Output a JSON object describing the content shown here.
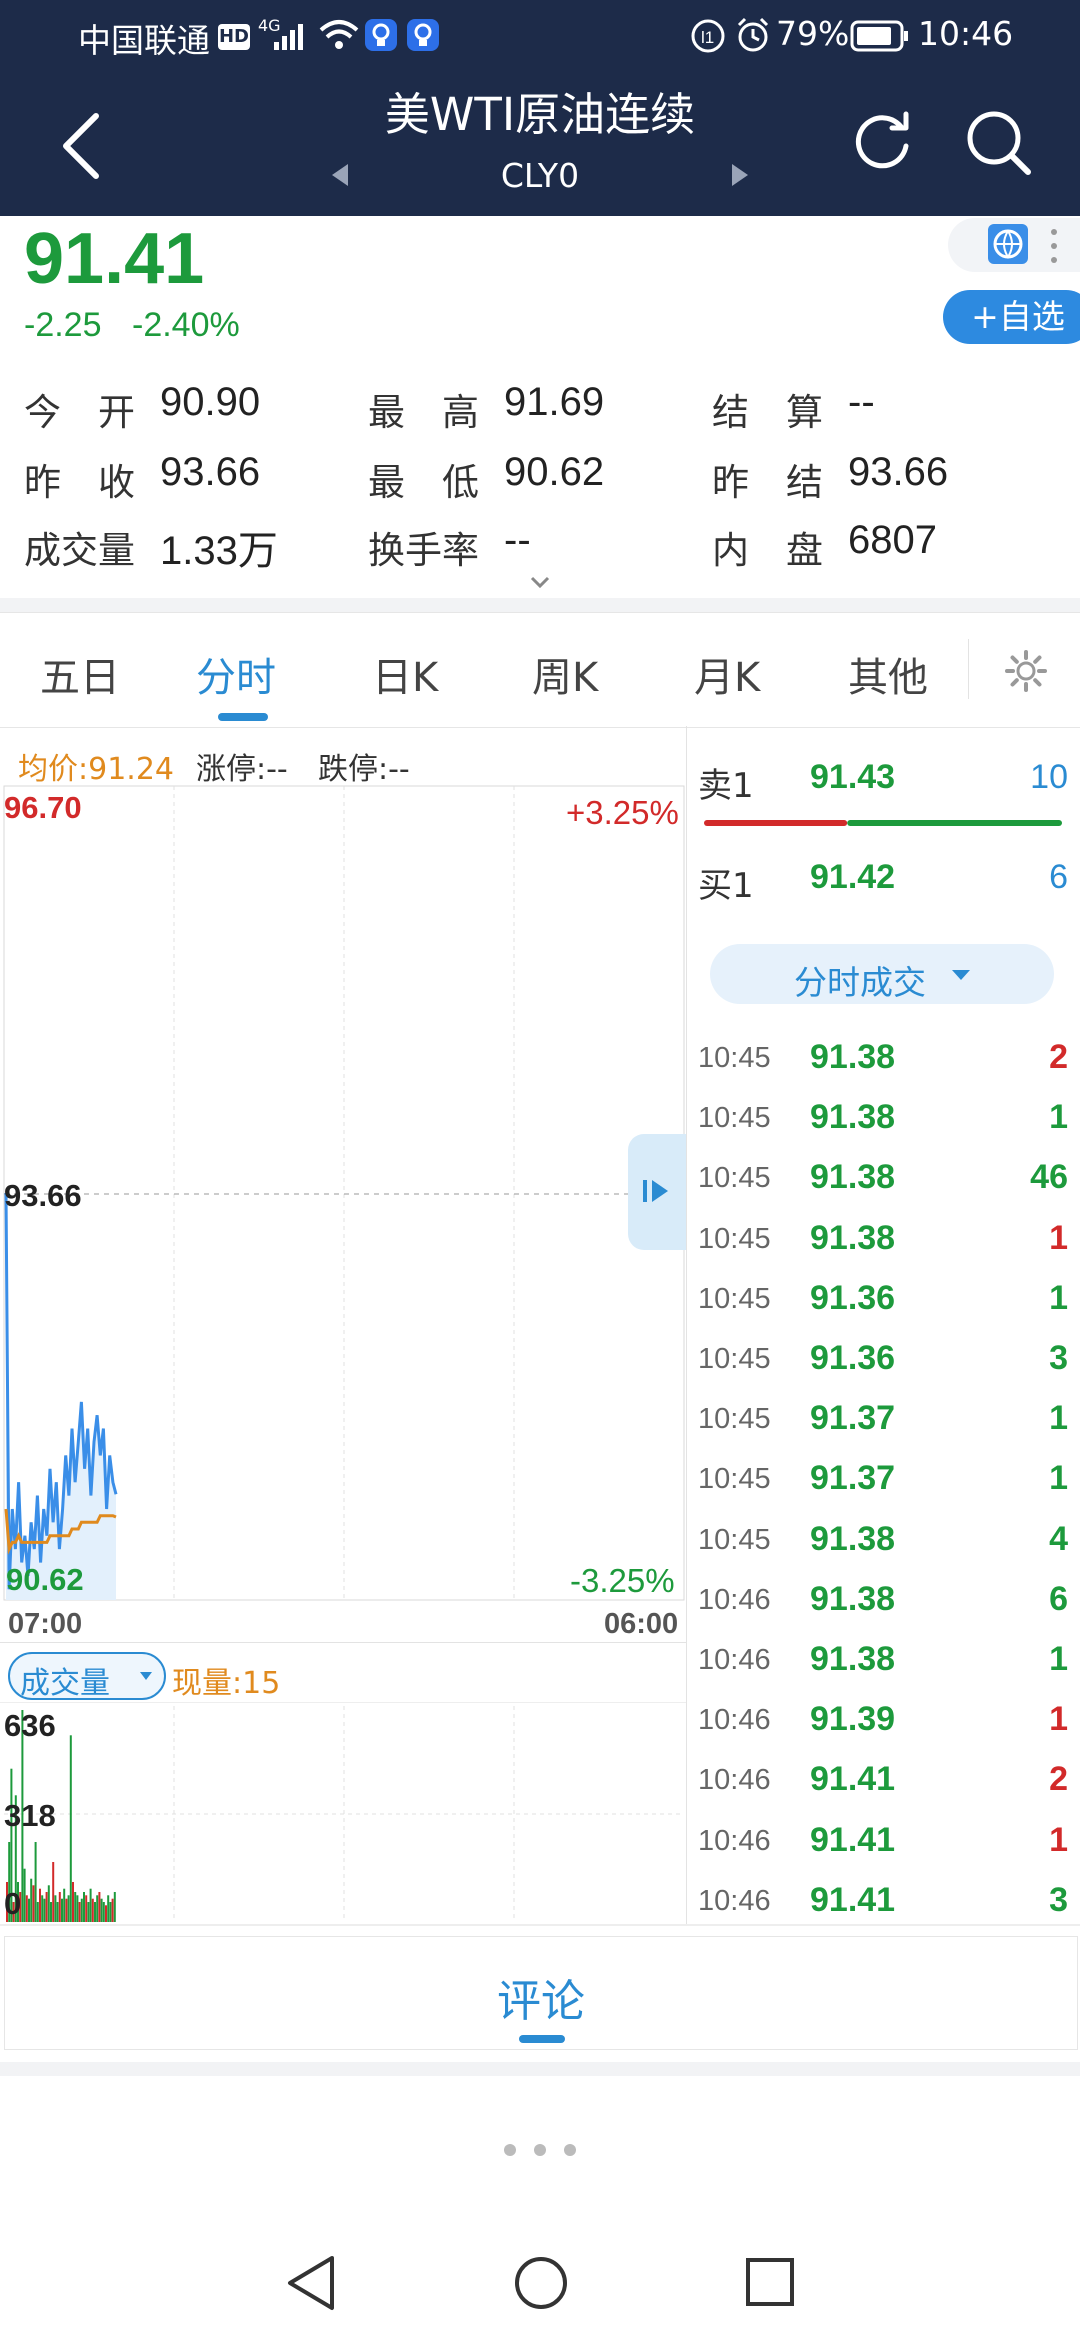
{
  "status_bar": {
    "carrier": "中国联通",
    "hd": "HD",
    "network": "4G",
    "battery": "79%",
    "time": "10:46"
  },
  "header": {
    "title": "美WTI原油连续",
    "code": "CLY0"
  },
  "quote": {
    "price": "91.41",
    "change": "-2.25",
    "change_pct": "-2.40%",
    "watch_button": "+自选",
    "fields": [
      {
        "label": "今　开",
        "value": "90.90"
      },
      {
        "label": "最　高",
        "value": "91.69"
      },
      {
        "label": "结　算",
        "value": "--"
      },
      {
        "label": "昨　收",
        "value": "93.66"
      },
      {
        "label": "最　低",
        "value": "90.62"
      },
      {
        "label": "昨　结",
        "value": "93.66"
      },
      {
        "label": "成交量",
        "value": "1.33万"
      },
      {
        "label": "换手率",
        "value": "--"
      },
      {
        "label": "内　盘",
        "value": "6807"
      }
    ]
  },
  "tabs": [
    "五日",
    "分时",
    "日K",
    "周K",
    "月K",
    "其他"
  ],
  "active_tab": "分时",
  "chart_header": {
    "avg_label": "均价:91.24",
    "limit_up": "涨停:--",
    "limit_down": "跌停:--"
  },
  "chart_data": {
    "type": "line",
    "y_max_label": "96.70",
    "y_mid_label": "93.66",
    "y_min_label": "90.62",
    "pct_max_label": "+3.25%",
    "pct_min_label": "-3.25%",
    "x_start": "07:00",
    "x_end": "06:00",
    "ylim": [
      90.62,
      96.7
    ],
    "prev_close": 93.66,
    "series": [
      {
        "values": [
          93.66,
          90.7,
          91.3,
          91.0,
          91.5,
          90.9,
          91.1,
          90.8,
          91.2,
          91.0,
          91.4,
          90.9,
          91.3,
          91.1,
          91.6,
          91.2,
          91.5,
          91.0,
          91.3,
          91.7,
          91.4,
          91.9,
          91.5,
          91.8,
          92.1,
          91.6,
          91.9,
          91.4,
          91.8,
          92.0,
          91.7,
          91.9,
          91.3,
          91.7,
          91.5,
          91.41
        ]
      },
      {
        "values": [
          91.3,
          91.0,
          91.05,
          91.05,
          91.1,
          91.05,
          91.05,
          91.05,
          91.05,
          91.05,
          91.05,
          91.05,
          91.05,
          91.05,
          91.1,
          91.1,
          91.1,
          91.1,
          91.1,
          91.1,
          91.1,
          91.15,
          91.15,
          91.15,
          91.2,
          91.2,
          91.2,
          91.2,
          91.2,
          91.2,
          91.25,
          91.25,
          91.25,
          91.25,
          91.25,
          91.24
        ]
      }
    ]
  },
  "volume": {
    "selector": "成交量",
    "current": "现量:15",
    "max_label": "636",
    "mid_label": "318",
    "min_label": "0",
    "ylim": [
      0,
      636
    ],
    "values": [
      120,
      240,
      460,
      60,
      380,
      120,
      90,
      636,
      160,
      80,
      70,
      130,
      110,
      240,
      60,
      100,
      80,
      70,
      90,
      110,
      60,
      180,
      80,
      60,
      90,
      70,
      100,
      70,
      80,
      560,
      120,
      90,
      80,
      60,
      70,
      90,
      80,
      60,
      100,
      70,
      60,
      80,
      90,
      70,
      60,
      50,
      80,
      60,
      70,
      90
    ]
  },
  "order_book": {
    "ask": {
      "label": "卖1",
      "price": "91.43",
      "volume": "10"
    },
    "bid": {
      "label": "买1",
      "price": "91.42",
      "volume": "6"
    },
    "ratio_sell": 0.4
  },
  "trades_selector": "分时成交",
  "trades": [
    {
      "time": "10:45",
      "price": "91.38",
      "volume": "2",
      "side": "buy"
    },
    {
      "time": "10:45",
      "price": "91.38",
      "volume": "1",
      "side": "sell"
    },
    {
      "time": "10:45",
      "price": "91.38",
      "volume": "46",
      "side": "sell"
    },
    {
      "time": "10:45",
      "price": "91.38",
      "volume": "1",
      "side": "buy"
    },
    {
      "time": "10:45",
      "price": "91.36",
      "volume": "1",
      "side": "sell"
    },
    {
      "time": "10:45",
      "price": "91.36",
      "volume": "3",
      "side": "sell"
    },
    {
      "time": "10:45",
      "price": "91.37",
      "volume": "1",
      "side": "sell"
    },
    {
      "time": "10:45",
      "price": "91.37",
      "volume": "1",
      "side": "sell"
    },
    {
      "time": "10:45",
      "price": "91.38",
      "volume": "4",
      "side": "sell"
    },
    {
      "time": "10:46",
      "price": "91.38",
      "volume": "6",
      "side": "sell"
    },
    {
      "time": "10:46",
      "price": "91.38",
      "volume": "1",
      "side": "sell"
    },
    {
      "time": "10:46",
      "price": "91.39",
      "volume": "1",
      "side": "buy"
    },
    {
      "time": "10:46",
      "price": "91.41",
      "volume": "2",
      "side": "buy"
    },
    {
      "time": "10:46",
      "price": "91.41",
      "volume": "1",
      "side": "buy"
    },
    {
      "time": "10:46",
      "price": "91.41",
      "volume": "3",
      "side": "sell"
    }
  ],
  "comment_tab": "评论",
  "colors": {
    "up": "#d22a2a",
    "down": "#1d9a3c",
    "accent": "#2a8bd2",
    "header": "#1d2b49",
    "avg": "#e08a1e"
  }
}
